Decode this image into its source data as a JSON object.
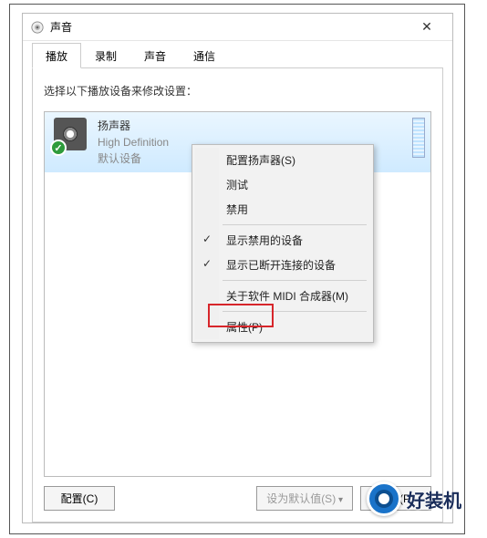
{
  "window": {
    "title": "声音"
  },
  "tabs": [
    {
      "label": "播放",
      "active": true
    },
    {
      "label": "录制",
      "active": false
    },
    {
      "label": "声音",
      "active": false
    },
    {
      "label": "通信",
      "active": false
    }
  ],
  "instruction": "选择以下播放设备来修改设置：",
  "device": {
    "name": "扬声器",
    "description": "High Definition",
    "status": "默认设备"
  },
  "context_menu": {
    "items": [
      {
        "label": "配置扬声器(S)"
      },
      {
        "label": "测试"
      },
      {
        "label": "禁用"
      },
      {
        "sep": true
      },
      {
        "label": "显示禁用的设备",
        "checked": true
      },
      {
        "label": "显示已断开连接的设备",
        "checked": true
      },
      {
        "sep": true
      },
      {
        "label": "关于软件 MIDI 合成器(M)"
      },
      {
        "sep": true
      },
      {
        "label": "属性(P)",
        "highlighted": true
      }
    ]
  },
  "buttons": {
    "configure": "配置(C)",
    "set_default": "设为默认值(S)",
    "properties": "属性(P)"
  },
  "watermark": "好装机"
}
